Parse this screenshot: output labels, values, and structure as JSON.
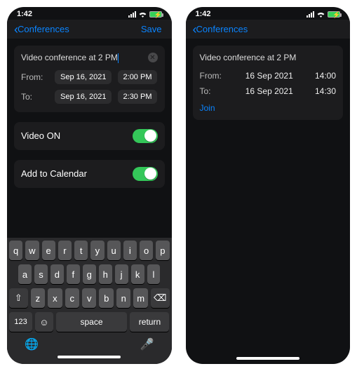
{
  "status": {
    "time": "1:42"
  },
  "nav": {
    "back": "Conferences",
    "save": "Save"
  },
  "left": {
    "title": "Video conference at 2 PM",
    "from_label": "From:",
    "to_label": "To:",
    "from_date": "Sep 16, 2021",
    "from_time": "2:00 PM",
    "to_date": "Sep 16, 2021",
    "to_time": "2:30 PM",
    "video_label": "Video ON",
    "calendar_label": "Add to Calendar"
  },
  "right": {
    "title": "Video conference at 2 PM",
    "from_label": "From:",
    "to_label": "To:",
    "from_date": "16 Sep 2021",
    "from_time": "14:00",
    "to_date": "16 Sep 2021",
    "to_time": "14:30",
    "join": "Join"
  },
  "keyboard": {
    "row1": [
      "q",
      "w",
      "e",
      "r",
      "t",
      "y",
      "u",
      "i",
      "o",
      "p"
    ],
    "row2": [
      "a",
      "s",
      "d",
      "f",
      "g",
      "h",
      "j",
      "k",
      "l"
    ],
    "row3": [
      "z",
      "x",
      "c",
      "v",
      "b",
      "n",
      "m"
    ],
    "num": "123",
    "space": "space",
    "ret": "return"
  }
}
